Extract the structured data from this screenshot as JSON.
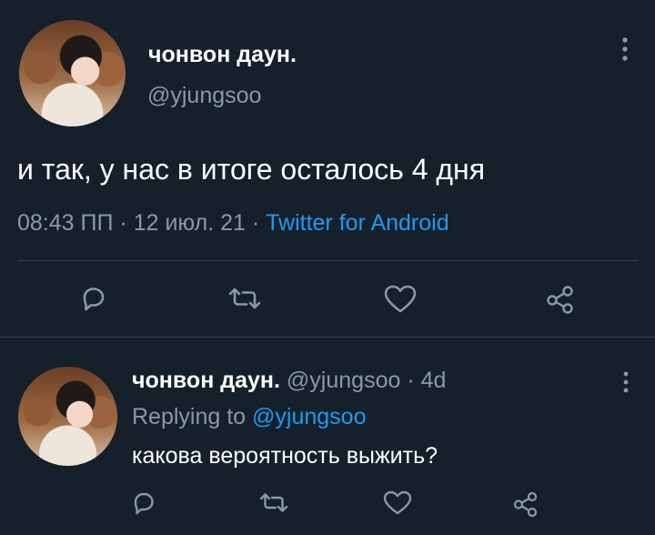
{
  "tweet": {
    "display_name": "чонвон даун.",
    "handle": "@yjungsoo",
    "text": "и так, у нас в итоге осталось 4 дня",
    "time": "08:43 ПП",
    "separator_1": "·",
    "date": "12 июл. 21",
    "separator_2": "·",
    "source": "Twitter for Android"
  },
  "reply": {
    "display_name": "чонвон даун.",
    "handle": "@yjungsoo",
    "separator": "·",
    "age": "4d",
    "replying_prefix": "Replying to",
    "replying_handle": "@yjungsoo",
    "text": "какова вероятность выжить?"
  },
  "icons": {
    "more": "more-vertical-icon",
    "reply": "reply-icon",
    "retweet": "retweet-icon",
    "like": "like-icon",
    "share": "share-icon"
  },
  "colors": {
    "background": "#15202b",
    "text": "#ffffff",
    "muted": "#8b98a5",
    "link": "#1d9bf0",
    "divider": "#38444d"
  }
}
